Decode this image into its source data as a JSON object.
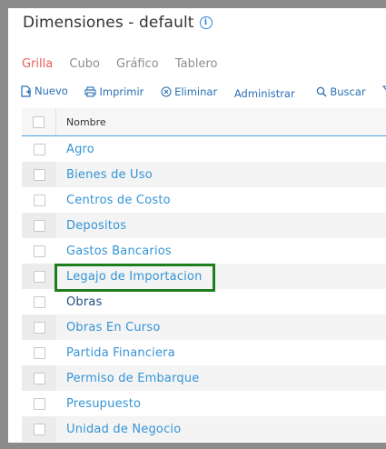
{
  "header": {
    "title": "Dimensiones - default",
    "info_icon": "info-icon"
  },
  "tabs": [
    {
      "label": "Grilla",
      "active": true
    },
    {
      "label": "Cubo",
      "active": false
    },
    {
      "label": "Gráfico",
      "active": false
    },
    {
      "label": "Tablero",
      "active": false
    }
  ],
  "toolbar": {
    "nuevo": "Nuevo",
    "imprimir": "Imprimir",
    "eliminar": "Eliminar",
    "administrar": "Administrar",
    "buscar": "Buscar"
  },
  "grid": {
    "column_name": "Nombre",
    "rows": [
      {
        "name": "Agro"
      },
      {
        "name": "Bienes de Uso"
      },
      {
        "name": "Centros de Costo"
      },
      {
        "name": "Depositos"
      },
      {
        "name": "Gastos Bancarios"
      },
      {
        "name": "Legajo de Importacion"
      },
      {
        "name": "Obras"
      },
      {
        "name": "Obras En Curso"
      },
      {
        "name": "Partida Financiera"
      },
      {
        "name": "Permiso de Embarque"
      },
      {
        "name": "Presupuesto"
      },
      {
        "name": "Unidad de Negocio"
      }
    ]
  },
  "colors": {
    "active_tab": "#ea5b5b",
    "link": "#3494d5",
    "toolbar": "#2a6fb3",
    "highlight": "#1e7e1e",
    "header_border": "#4aa3df"
  }
}
